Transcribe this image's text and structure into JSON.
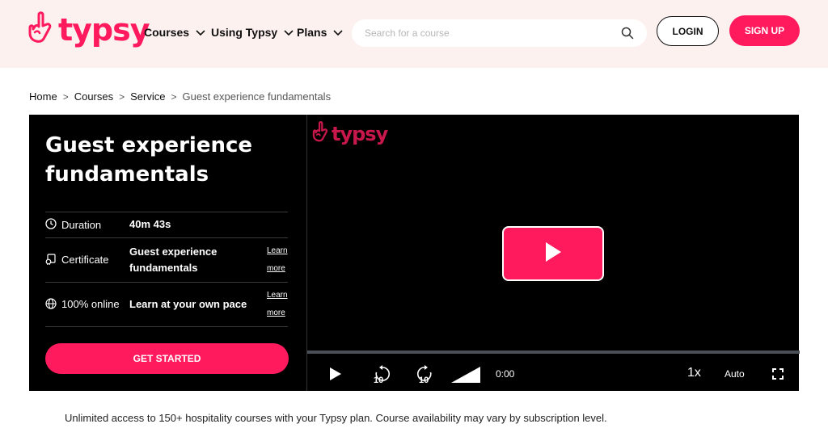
{
  "header": {
    "logo_text": "typsy",
    "nav": [
      {
        "label": "Courses"
      },
      {
        "label": "Using Typsy"
      },
      {
        "label": "Plans"
      }
    ],
    "search": {
      "placeholder": "Search for a course",
      "value": ""
    },
    "login_label": "LOGIN",
    "signup_label": "SIGN UP"
  },
  "breadcrumb": {
    "items": [
      "Home",
      "Courses",
      "Service"
    ],
    "separator": ">",
    "current": "Guest experience fundamentals"
  },
  "course": {
    "title": "Guest experience fundamentals",
    "rows": [
      {
        "icon": "clock-icon",
        "label": "Duration",
        "value": "40m 43s"
      },
      {
        "icon": "certificate-icon",
        "label": "Certificate",
        "value": "Guest experience fundamentals",
        "link": "Learn more"
      },
      {
        "icon": "globe-icon",
        "label": "100% online",
        "value": "Learn at your own pace",
        "link": "Learn more"
      }
    ],
    "cta_label": "GET STARTED"
  },
  "video": {
    "watermark": "typsy",
    "time": "0:00",
    "speed": "1x",
    "quality": "Auto",
    "progress": 0,
    "rewind_seconds": "10",
    "forward_seconds": "10"
  },
  "footnote": "Unlimited access to 150+ hospitality courses with your Typsy plan. Course availability may vary by subscription level.",
  "colors": {
    "brand": "#ff1a5e",
    "header_bg": "#fdf1ef",
    "panel_bg": "#000000"
  }
}
